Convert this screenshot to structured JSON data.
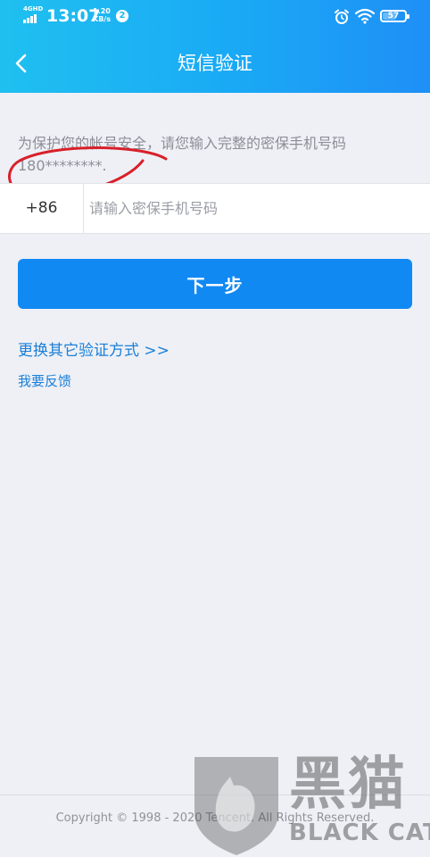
{
  "status_bar": {
    "network": "4GHD",
    "time": "13:07",
    "speed_value": "1.20",
    "speed_unit": "KB/s",
    "notification_count": "2",
    "battery": "57"
  },
  "header": {
    "title": "短信验证"
  },
  "main": {
    "hint_text": "为保护您的帐号安全，请您输入完整的密保手机号码180********.",
    "country_code": "+86",
    "phone_placeholder": "请输入密保手机号码",
    "phone_value": "",
    "next_label": "下一步",
    "switch_method_label": "更换其它验证方式 >>",
    "feedback_label": "我要反馈"
  },
  "footer": {
    "copyright": "Copyright © 1998 - 2020 Tencent. All Rights Reserved."
  },
  "watermark": {
    "cn": "黑猫",
    "en": "BLACK CAT"
  },
  "colors": {
    "header_gradient_start": "#1fc0f0",
    "header_gradient_end": "#1e8ff6",
    "primary_button": "#1189f3",
    "link": "#1a7fd7",
    "annotation": "#d8202a",
    "background": "#eef0f6"
  }
}
